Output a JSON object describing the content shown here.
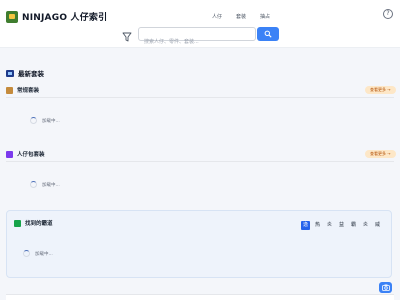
{
  "app": {
    "title": "NINJAGO 人仔索引"
  },
  "nav": {
    "items": [
      "人仔",
      "套装",
      "抽占"
    ]
  },
  "help": {
    "label": "?"
  },
  "search": {
    "placeholder": "搜索人仔、零件、套装..."
  },
  "page": {
    "title": "最新套装"
  },
  "sections": [
    {
      "label": "常规套装",
      "more": "查看更多 →",
      "loading": "加载中..."
    },
    {
      "label": "人仔包套装",
      "more": "查看更多 →",
      "loading": "加载中..."
    }
  ],
  "panel": {
    "title": "找到的霸道",
    "elements": [
      "逸",
      "热",
      "炎",
      "益",
      "霸",
      "炎",
      "威"
    ],
    "loading": "加载中..."
  },
  "colors": {
    "accent": "#3b82f6",
    "more_bg": "#fde7c7",
    "more_text": "#b45309",
    "panel_bg": "#eef3fb"
  },
  "icons": {
    "filter": "filter-icon",
    "search": "search-icon",
    "help": "help-circle-icon",
    "camera": "camera-icon"
  }
}
